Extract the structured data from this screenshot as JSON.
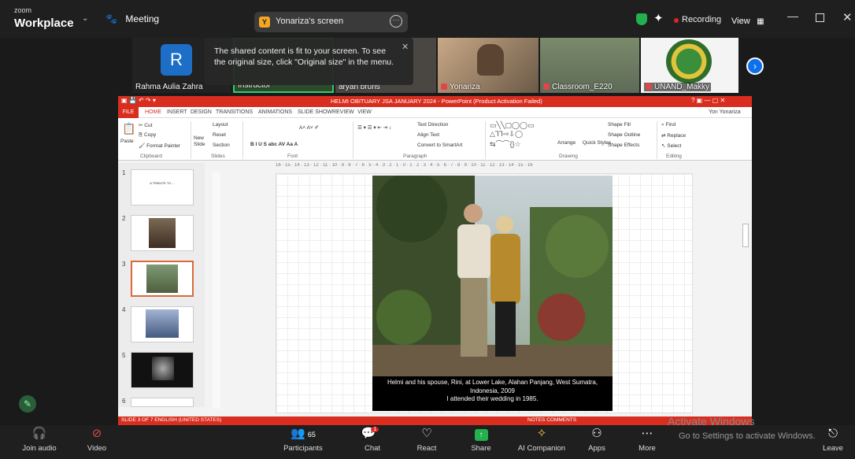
{
  "app": {
    "brand_small": "zoom",
    "brand_large": "Workplace",
    "meeting_label": "Meeting"
  },
  "share": {
    "badge": "Y",
    "label": "Yonariza's screen"
  },
  "status": {
    "recording": "Recording",
    "view": "View"
  },
  "notice": {
    "text": "The shared content is fit to your screen. To see the original size, click \"Original size\" in the menu."
  },
  "participants_strip": [
    {
      "name": "Rahma Aulia Zahra",
      "initial": "R"
    },
    {
      "name": "Instructor"
    },
    {
      "name": "aryan bruns"
    },
    {
      "name": "Yonariza"
    },
    {
      "name": "Classroom_E220"
    },
    {
      "name": "UNAND_Makky"
    }
  ],
  "ppt": {
    "title": "HELMI OBITUARY JSA JANUARY 2024 - PowerPoint (Product Activation Failed)",
    "user": "Yon Yonariza",
    "tabs": [
      "FILE",
      "HOME",
      "INSERT",
      "DESIGN",
      "TRANSITIONS",
      "ANIMATIONS",
      "SLIDE SHOW",
      "REVIEW",
      "VIEW"
    ],
    "ribbon": {
      "cut": "Cut",
      "copy": "Copy",
      "paste": "Paste",
      "format_painter": "Format Painter",
      "new_slide": "New Slide",
      "layout": "Layout",
      "reset": "Reset",
      "section": "Section",
      "text_direction": "Text Direction",
      "align_text": "Align Text",
      "convert_smartart": "Convert to SmartArt",
      "arrange": "Arrange",
      "quick_styles": "Quick Styles",
      "shape_fill": "Shape Fill",
      "shape_outline": "Shape Outline",
      "shape_effects": "Shape Effects",
      "find": "Find",
      "replace": "Replace",
      "select": "Select"
    },
    "groups": [
      "Clipboard",
      "Slides",
      "Font",
      "Paragraph",
      "Drawing",
      "Editing"
    ],
    "ruler": "16 · 15 · 14 · 13 · 12 · 11 · 10 · 9 · 8 · 7 · 6 · 5 · 4 · 3 · 2 · 1 · 0 · 1 · 2 · 3 · 4 · 5 · 6 · 7 · 8 · 9 · 10 · 11 · 12 · 13 · 14 · 15 · 16",
    "thumbnails": [
      "1",
      "2",
      "3",
      "4",
      "5",
      "6"
    ],
    "thumb1_title": "A TRIBUTE TO ...",
    "caption_line1": "Helmi and his spouse, Rini, at Lower Lake, Alahan Panjang, West Sumatra,",
    "caption_line2": "Indonesia, 2009",
    "caption_line3": "I attended their wedding in 1985.",
    "status_left": "SLIDE 3 OF 7     ENGLISH (UNITED STATES)",
    "status_right": "NOTES     COMMENTS"
  },
  "toolbar": {
    "join_audio": "Join audio",
    "video": "Video",
    "participants": "Participants",
    "participants_count": "65",
    "chat": "Chat",
    "chat_badge": "1",
    "react": "React",
    "share": "Share",
    "ai_companion": "AI Companion",
    "apps": "Apps",
    "more": "More",
    "leave": "Leave"
  },
  "watermark": {
    "line1": "Activate Windows",
    "line2": "Go to Settings to activate Windows."
  },
  "colors": {
    "zoom_blue": "#0e71eb",
    "ppt_red": "#d92e1f",
    "share_green": "#22b14c",
    "record_red": "#e02424"
  }
}
